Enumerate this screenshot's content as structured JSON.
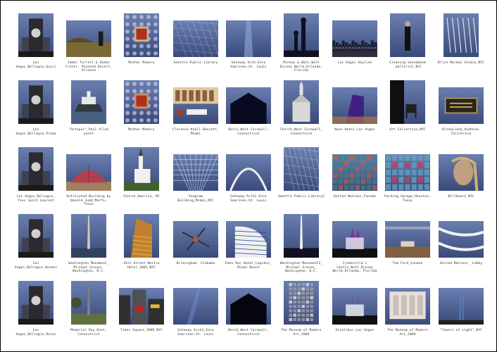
{
  "rows": [
    {
      "cells": [
        {
          "caption": "Las Vegas_Bellagio_Gucci",
          "icon": "casino-building",
          "colors": [
            "#3a4a7a",
            "#6a7fb0",
            "#1a1a1a"
          ],
          "portrait": true
        },
        {
          "caption": "James Turrell & Roden Crater, Painted Desert, Arizona",
          "icon": "desert-landscape",
          "colors": [
            "#8fb0d8",
            "#6a5a30",
            "#1a1a1a"
          ],
          "portrait": false
        },
        {
          "caption": "Mother Memory",
          "icon": "patterned-wall",
          "colors": [
            "#8898c0",
            "#c8b090",
            "#b03020"
          ],
          "portrait": true
        },
        {
          "caption": "Seattle Public Library",
          "icon": "glass-facade",
          "colors": [
            "#2a3a5a",
            "#6080a0",
            "#a0b8d0"
          ],
          "portrait": false
        },
        {
          "caption": "Gateway Arch_Eero Saarinen_St. Louis",
          "icon": "arch-blue",
          "colors": [
            "#1a2a60",
            "#3050a0",
            "#90a8d8"
          ],
          "portrait": false
        },
        {
          "caption": "Mickey & Walt_Walt Disney World_Orlando, Florida",
          "icon": "silhouette-statue",
          "colors": [
            "#2a3080",
            "#8090d0",
            "#101020"
          ],
          "portrait": true
        },
        {
          "caption": "Las Vegas Skyline",
          "icon": "night-skyline",
          "colors": [
            "#050510",
            "#303040",
            "#e0e0e0"
          ],
          "portrait": false
        },
        {
          "caption": "Cleaning Sonnabend _Gallerist_NYC",
          "icon": "standing-figure",
          "colors": [
            "#e8e8e8",
            "#c0c0c0",
            "#101010"
          ],
          "portrait": true
        },
        {
          "caption": "Brice Marden Studio_NYC",
          "icon": "studio-interior",
          "colors": [
            "#202020",
            "#808080",
            "#e0e0e0"
          ],
          "portrait": true
        }
      ]
    },
    {
      "cells": [
        {
          "caption": "Las Vegas_Bellagio_Prada",
          "icon": "casino-building",
          "colors": [
            "#3a4a7a",
            "#6a7fb0",
            "#1a1a1a"
          ],
          "portrait": true
        },
        {
          "caption": "\"Octopus\"_Paul Allen yacht",
          "icon": "yacht",
          "colors": [
            "#90a8c8",
            "#d0d8e0",
            "#303840"
          ],
          "portrait": true
        },
        {
          "caption": "Mother Memory",
          "icon": "patterned-wall",
          "colors": [
            "#8898c0",
            "#c89060",
            "#b03020"
          ],
          "portrait": true
        },
        {
          "caption": "Florence Knoll Bassett_ Miami",
          "icon": "living-room",
          "colors": [
            "#c8a060",
            "#f0e8d8",
            "#a04020"
          ],
          "portrait": false
        },
        {
          "caption": "Barn1_West Cornwall, Connecticut",
          "icon": "barn-blue",
          "colors": [
            "#1a2a60",
            "#3060b0",
            "#0a0a20"
          ],
          "portrait": false
        },
        {
          "caption": "Church_West Cornwall, Connecticut",
          "icon": "church-night",
          "colors": [
            "#101020",
            "#303050",
            "#e0e0e0"
          ],
          "portrait": true
        },
        {
          "caption": "Wynn Hotel_Las Vegas",
          "icon": "hotel-night",
          "colors": [
            "#101030",
            "#402080",
            "#c08040"
          ],
          "portrait": false
        },
        {
          "caption": "Art Collection_NYC",
          "icon": "chair-interior",
          "colors": [
            "#f0f0f0",
            "#909090",
            "#101010"
          ],
          "portrait": true
        },
        {
          "caption": "Disneyland_Anaheim, California",
          "icon": "plaque",
          "colors": [
            "#101010",
            "#404040",
            "#c0a060"
          ],
          "portrait": false
        }
      ]
    },
    {
      "cells": [
        {
          "caption": "Las Vegas_Bellagio_ Yves Saint Laurent",
          "icon": "casino-building",
          "colors": [
            "#3a4a7a",
            "#6a7fb0",
            "#1a1a1a"
          ],
          "portrait": true
        },
        {
          "caption": "Unfinished Building by Donald Judd_Marfa, Texas",
          "icon": "quonset-hut",
          "colors": [
            "#a0c0e0",
            "#b04050",
            "#a08060"
          ],
          "portrait": false
        },
        {
          "caption": "Church_America, NY",
          "icon": "church-day",
          "colors": [
            "#a0b8d0",
            "#f0f0f0",
            "#406030"
          ],
          "portrait": true
        },
        {
          "caption": "Seagram Building_Miami_NYC",
          "icon": "grid-ceiling",
          "colors": [
            "#1a2a60",
            "#6090d0",
            "#c0d8f0"
          ],
          "portrait": false
        },
        {
          "caption": "Gateway Arch2_Eero Saarinen_St. Louis",
          "icon": "arch-curve",
          "colors": [
            "#1a3080",
            "#4a70c0",
            "#f0f0f0"
          ],
          "portrait": false
        },
        {
          "caption": "Seattle Public Library2",
          "icon": "glass-facade",
          "colors": [
            "#1a2a50",
            "#5070a0",
            "#c0d0e0"
          ],
          "portrait": true
        },
        {
          "caption": "United Nations_Facade",
          "icon": "facade-grid",
          "colors": [
            "#101830",
            "#408080",
            "#c06030"
          ],
          "portrait": false
        },
        {
          "caption": "Parking Garage_Houston, Texas",
          "icon": "facade-colored",
          "colors": [
            "#303040",
            "#c04060",
            "#60a0c0"
          ],
          "portrait": false
        },
        {
          "caption": "Billboard_NYC",
          "icon": "billboard-face",
          "colors": [
            "#101010",
            "#c0a080",
            "#606060"
          ],
          "portrait": false
        }
      ]
    },
    {
      "cells": [
        {
          "caption": "Las Vegas_Bellagio_Hermes",
          "icon": "casino-building",
          "colors": [
            "#3a4a7a",
            "#6a7fb0",
            "#1a1a1a"
          ],
          "portrait": true
        },
        {
          "caption": "Washington Monument_ Michael Graves_ Washington, D.C.",
          "icon": "monument-day",
          "colors": [
            "#5080c0",
            "#a0c0e0",
            "#304020"
          ],
          "portrait": true
        },
        {
          "caption": "41st Street Westin Hotel_2003_NYC",
          "icon": "hotel-stripes",
          "colors": [
            "#1a2a70",
            "#c08030",
            "#e0a040"
          ],
          "portrait": true
        },
        {
          "caption": "Birmingham, Alabama",
          "icon": "sculpture-sky",
          "colors": [
            "#1a3080",
            "#5070c0",
            "#303030"
          ],
          "portrait": false
        },
        {
          "caption": "Eden Roc Hotel_Lapidus_ Miami Beach",
          "icon": "hotel-white",
          "colors": [
            "#0a1a60",
            "#2040a0",
            "#f0f0f0"
          ],
          "portrait": false
        },
        {
          "caption": "Washington Monument2_ Michael Graves_ Washington, D.C.",
          "icon": "monument-night",
          "colors": [
            "#101030",
            "#304080",
            "#f0f0f0"
          ],
          "portrait": true
        },
        {
          "caption": "Cinderella's Castle_Walt Disney World_Orlando, Florida",
          "icon": "castle-lights",
          "colors": [
            "#101020",
            "#8030a0",
            "#f0e0f0"
          ],
          "portrait": false
        },
        {
          "caption": "Tom Ford_London",
          "icon": "lobby-interior",
          "colors": [
            "#201810",
            "#806040",
            "#e0d0c0"
          ],
          "portrait": false
        },
        {
          "caption": "United Nations _Lobby",
          "icon": "lobby-curves",
          "colors": [
            "#101010",
            "#606060",
            "#f0f0f0"
          ],
          "portrait": false
        }
      ]
    },
    {
      "cells": [
        {
          "caption": "Las Vegas_Bellagio_Rolex",
          "icon": "casino-building",
          "colors": [
            "#3a4a7a",
            "#6a7fb0",
            "#1a1a1a"
          ],
          "portrait": true
        },
        {
          "caption": "Memorial Day_Kent, Connecticut",
          "icon": "obelisk-park",
          "colors": [
            "#a0b8d0",
            "#607040",
            "#808080"
          ],
          "portrait": true
        },
        {
          "caption": "Times Square_2005_NYC",
          "icon": "times-square",
          "colors": [
            "#d0d8e0",
            "#303030",
            "#c02020"
          ],
          "portrait": false
        },
        {
          "caption": "Gateway Arch3_Eero Saarinen_St. Louis",
          "icon": "arch-dark",
          "colors": [
            "#0a1040",
            "#3050a0",
            "#7090d0"
          ],
          "portrait": false
        },
        {
          "caption": "Barn2_West Cornwall, Connecticut",
          "icon": "barn-dark",
          "colors": [
            "#101030",
            "#2a3a80",
            "#050510"
          ],
          "portrait": false
        },
        {
          "caption": "The Museum of Modern Art_2004",
          "icon": "museum-facade",
          "colors": [
            "#101010",
            "#505050",
            "#a0a0a0"
          ],
          "portrait": true
        },
        {
          "caption": "Excalibur_Las Vegas",
          "icon": "castle-night",
          "colors": [
            "#050510",
            "#6060a0",
            "#f0f0f0"
          ],
          "portrait": false
        },
        {
          "caption": "The Museum of Modern Art_2004",
          "icon": "museum-interior",
          "colors": [
            "#202020",
            "#909090",
            "#e8e0d8"
          ],
          "portrait": false
        },
        {
          "caption": "\"Towers of Light\"_NYC",
          "icon": "light-beams",
          "colors": [
            "#000000",
            "#101830",
            "#6080c0"
          ],
          "portrait": false
        }
      ]
    }
  ]
}
